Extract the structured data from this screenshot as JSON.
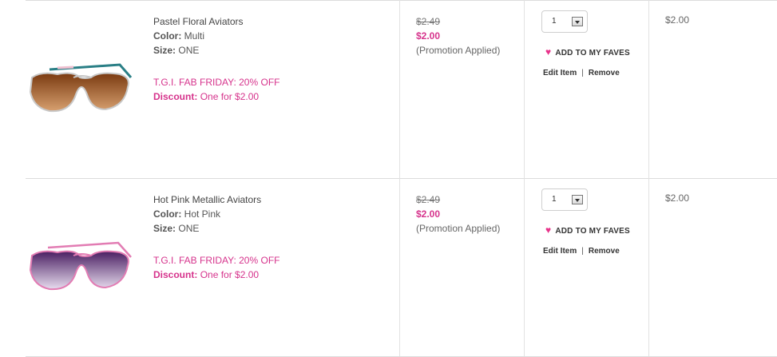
{
  "items": [
    {
      "name": "Pastel Floral Aviators",
      "color_label": "Color:",
      "color_value": "Multi",
      "size_label": "Size:",
      "size_value": "ONE",
      "promo_title": "T.G.I. FAB FRIDAY: 20% OFF",
      "discount_label": "Discount:",
      "discount_value": "One for $2.00",
      "original_price": "$2.49",
      "sale_price": "$2.00",
      "price_note": "(Promotion Applied)",
      "quantity": "1",
      "faves_label": "ADD TO MY FAVES",
      "edit_label": "Edit Item",
      "separator": "|",
      "remove_label": "Remove",
      "total": "$2.00",
      "lens_color": "#8a4a18",
      "frame_color": "#c8c8c8",
      "temple_color": "#2a7f86"
    },
    {
      "name": "Hot Pink Metallic Aviators",
      "color_label": "Color:",
      "color_value": "Hot Pink",
      "size_label": "Size:",
      "size_value": "ONE",
      "promo_title": "T.G.I. FAB FRIDAY: 20% OFF",
      "discount_label": "Discount:",
      "discount_value": "One for $2.00",
      "original_price": "$2.49",
      "sale_price": "$2.00",
      "price_note": "(Promotion Applied)",
      "quantity": "1",
      "faves_label": "ADD TO MY FAVES",
      "edit_label": "Edit Item",
      "separator": "|",
      "remove_label": "Remove",
      "total": "$2.00",
      "lens_color": "#5a2a6e",
      "frame_color": "#e27cb3",
      "temple_color": "#e27cb3"
    }
  ],
  "colors": {
    "accent_pink": "#d6338c",
    "heart_pink": "#e8328a",
    "divider": "#dcdcdc"
  }
}
